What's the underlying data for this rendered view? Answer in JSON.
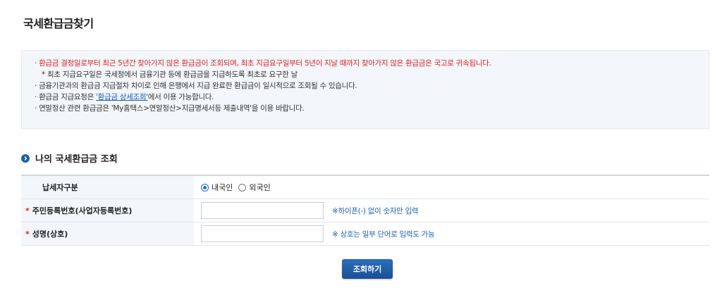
{
  "page": {
    "title": "국세환급금찾기"
  },
  "notice": {
    "line1": "· 환급금 결정일로부터 최근 5년간 찾아가지 않은 환급금이 조회되며, 최초 지급요구일부터 5년이 지날 때까지 찾아가지 않은 환급금은 국고로 귀속됩니다.",
    "line2": "* 최초 지급요구일은 국세청에서 금융기관 등에 환급금을 지급하도록 최초로 요구한 날",
    "line3": "· 금융기관과의 환급금 지급절차 차이로 인해 은행에서 지급 완료한 환급금이 일시적으로 조회될 수 있습니다.",
    "line4_prefix": "· 환급금 지급요청은 ",
    "line4_link": "'환급금 상세조회'",
    "line4_suffix": "에서 이용 가능합니다.",
    "line5": "· 연말정산 관련 환급금은 'My홈택스>연말정산>지급명세서등 제출내역'을 이용 바랍니다."
  },
  "section": {
    "title": "나의 국세환급금 조회"
  },
  "form": {
    "taxpayer_type_label": "납세자구분",
    "radio_domestic": "내국인",
    "radio_foreign": "외국인",
    "selected": "내국인",
    "resident_label": "주민등록번호(사업자등록번호)",
    "resident_value": "",
    "resident_hint": "※하이픈(-) 없이 숫자만 입력",
    "name_label": "성명(상호)",
    "name_value": "",
    "name_hint": "※ 상호는 일부 단어로 입력도 가능",
    "required_mark": "*"
  },
  "actions": {
    "submit_label": "조회하기"
  },
  "colors": {
    "accent": "#1f5fae",
    "warning": "#e02020",
    "link": "#1a57b8"
  }
}
